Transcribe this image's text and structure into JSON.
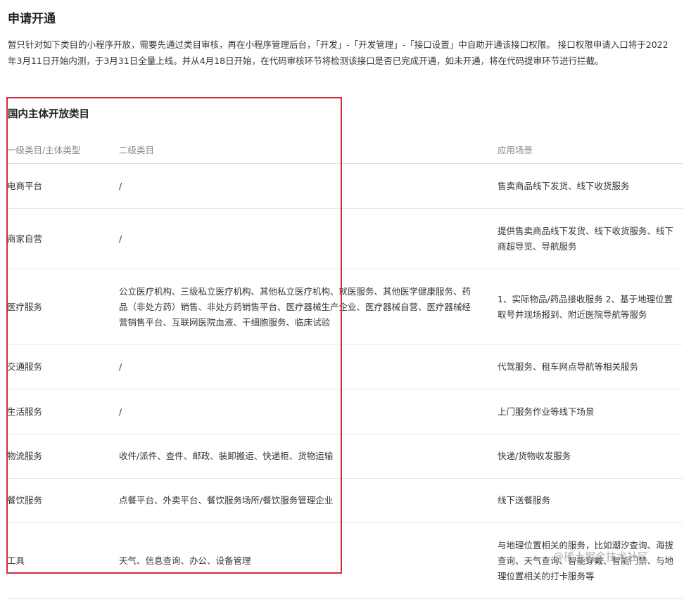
{
  "page": {
    "title": "申请开通",
    "intro": "暂只针对如下类目的小程序开放，需要先通过类目审核，再在小程序管理后台，「开发」-「开发管理」-「接口设置」中自助开通该接口权限。 接口权限申请入口将于2022年3月11日开始内测，于3月31日全量上线。并从4月18日开始，在代码审核环节将检测该接口是否已完成开通，如未开通，将在代码提审环节进行拦截。"
  },
  "section": {
    "title": "国内主体开放类目"
  },
  "table": {
    "headers": [
      "一级类目/主体类型",
      "二级类目",
      "应用场景"
    ],
    "rows": [
      {
        "primary": "电商平台",
        "secondary": "/",
        "scene": "售卖商品线下发货、线下收货服务"
      },
      {
        "primary": "商家自营",
        "secondary": "/",
        "scene": "提供售卖商品线下发货、线下收货服务、线下商超导览、导航服务"
      },
      {
        "primary": "医疗服务",
        "secondary": "公立医疗机构、三级私立医疗机构、其他私立医疗机构、就医服务、其他医学健康服务、药品（非处方药）销售、非处方药销售平台、医疗器械生产企业、医疗器械自营、医疗器械经营销售平台、互联网医院血液、干细胞服务、临床试验",
        "scene": "1、实际物品/药品接收服务 2、基于地理位置取号并现场报到、附近医院导航等服务"
      },
      {
        "primary": "交通服务",
        "secondary": "/",
        "scene": "代驾服务、租车网点导航等相关服务"
      },
      {
        "primary": "生活服务",
        "secondary": "/",
        "scene": "上门服务作业等线下场景"
      },
      {
        "primary": "物流服务",
        "secondary": "收件/派件、查件、邮政、装卸搬运、快递柜、货物运输",
        "scene": "快递/货物收发服务"
      },
      {
        "primary": "餐饮服务",
        "secondary": "点餐平台、外卖平台、餐饮服务场所/餐饮服务管理企业",
        "scene": "线下送餐服务"
      },
      {
        "primary": "工具",
        "secondary": "天气、信息查询、办公、设备管理",
        "scene": "与地理位置相关的服务，比如潮汐查询、海拔查询、天气查询、智能穿戴、智能门禁、与地理位置相关的打卡服务等"
      }
    ]
  },
  "watermark": "@稀土掘金技术社区"
}
